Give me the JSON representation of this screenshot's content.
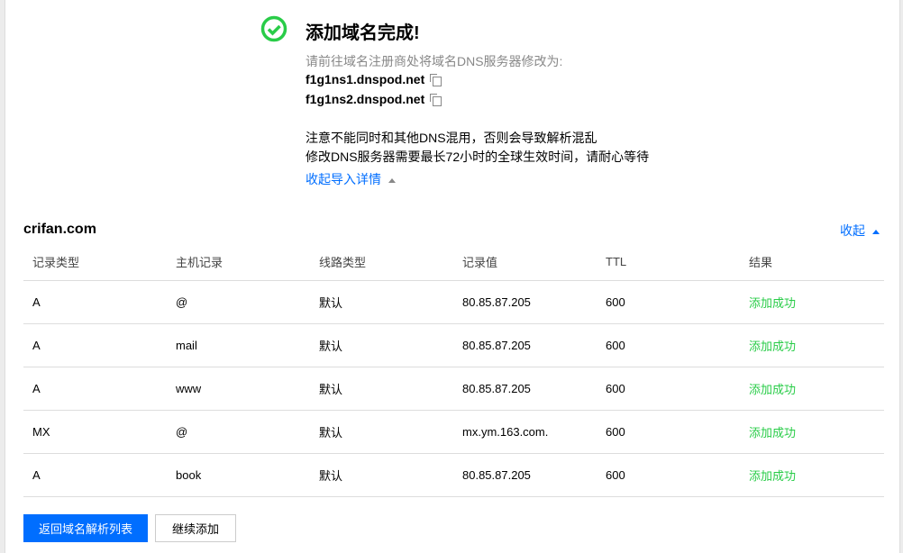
{
  "header": {
    "title": "添加域名完成!",
    "hint": "请前往域名注册商处将域名DNS服务器修改为:",
    "nameservers": [
      "f1g1ns1.dnspod.net",
      "f1g1ns2.dnspod.net"
    ],
    "notes": [
      "注意不能同时和其他DNS混用，否则会导致解析混乱",
      "修改DNS服务器需要最长72小时的全球生效时间，请耐心等待"
    ],
    "collapse_detail": "收起导入详情",
    "success_color": "#29cc48"
  },
  "domain": {
    "name": "crifan.com",
    "collapse": "收起"
  },
  "table": {
    "columns": [
      "记录类型",
      "主机记录",
      "线路类型",
      "记录值",
      "TTL",
      "结果"
    ],
    "rows": [
      [
        "A",
        "@",
        "默认",
        "80.85.87.205",
        "600",
        "添加成功"
      ],
      [
        "A",
        "mail",
        "默认",
        "80.85.87.205",
        "600",
        "添加成功"
      ],
      [
        "A",
        "www",
        "默认",
        "80.85.87.205",
        "600",
        "添加成功"
      ],
      [
        "MX",
        "@",
        "默认",
        "mx.ym.163.com.",
        "600",
        "添加成功"
      ],
      [
        "A",
        "book",
        "默认",
        "80.85.87.205",
        "600",
        "添加成功"
      ]
    ]
  },
  "buttons": {
    "back": "返回域名解析列表",
    "continue": "继续添加"
  }
}
